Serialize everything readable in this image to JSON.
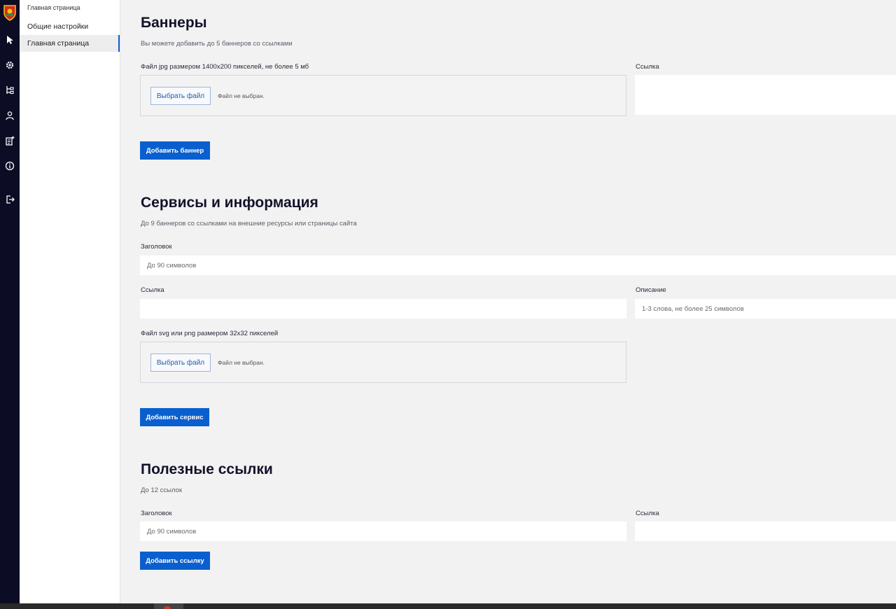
{
  "rail": {
    "icons": [
      "coat-of-arms",
      "cursor-icon",
      "gear-icon",
      "tree-icon",
      "user-icon",
      "document-add-icon",
      "info-icon",
      "logout-icon"
    ]
  },
  "subnav": {
    "breadcrumb": "Главная страница",
    "items": [
      {
        "label": "Общие настройки",
        "active": false
      },
      {
        "label": "Главная страница",
        "active": true
      }
    ]
  },
  "banners": {
    "title": "Баннеры",
    "subtitle": "Вы можете добавить до 5 баннеров со ссылками",
    "file_label": "Файл jpg размером 1400x200 пикселей, не более 5 мб",
    "file_button": "Выбрать файл",
    "file_status": "Файл не выбран.",
    "link_label": "Ссылка",
    "link_value": "",
    "add_button": "Добавить баннер"
  },
  "services": {
    "title": "Сервисы и информация",
    "subtitle": "До 9 баннеров со ссылками на внешние ресурсы или страницы сайта",
    "heading_label": "Заголовок",
    "heading_placeholder": "До 90 символов",
    "link_label": "Ссылка",
    "link_value": "",
    "description_label": "Описание",
    "description_placeholder": "1-3 слова, не более 25 символов",
    "file_label": "Файл svg или png размером 32x32 пикселей",
    "file_button": "Выбрать файл",
    "file_status": "Файл не выбран.",
    "add_button": "Добавить сервис"
  },
  "useful_links": {
    "title": "Полезные ссылки",
    "subtitle": "До 12 ссылок",
    "heading_label": "Заголовок",
    "heading_placeholder": "До 90 символов",
    "link_label": "Ссылка",
    "link_value": "",
    "add_button": "Добавить ссылку"
  },
  "colors": {
    "rail": "#0c0c24",
    "accent": "#0a5fcf",
    "page_bg": "#f2f2f2"
  }
}
